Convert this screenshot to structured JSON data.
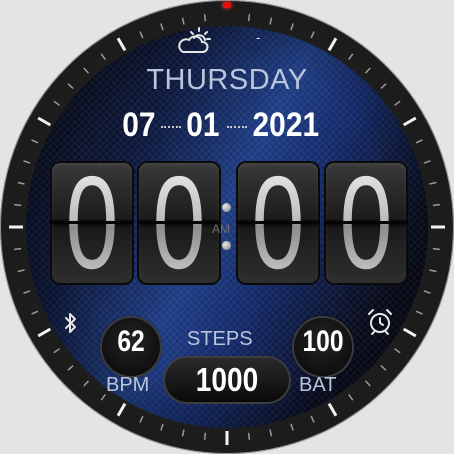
{
  "weather": {
    "icon": "partly-cloudy-icon",
    "temperature": "-"
  },
  "date": {
    "day_name": "THURSDAY",
    "month": "07",
    "day": "01",
    "year": "2021"
  },
  "time": {
    "hour_tens": "0",
    "hour_ones": "0",
    "minute_tens": "0",
    "minute_ones": "0",
    "period": "AM"
  },
  "status": {
    "bluetooth_icon": "bluetooth-icon",
    "alarm_icon": "alarm-clock-icon"
  },
  "heart_rate": {
    "value": "62",
    "label": "BPM"
  },
  "steps": {
    "label": "STEPS",
    "value": "1000"
  },
  "battery": {
    "value": "100",
    "label": "BAT"
  },
  "colors": {
    "accent_blue": "#1d3c84",
    "text_light_blue": "#b9c6db",
    "top_marker": "#e01010"
  }
}
